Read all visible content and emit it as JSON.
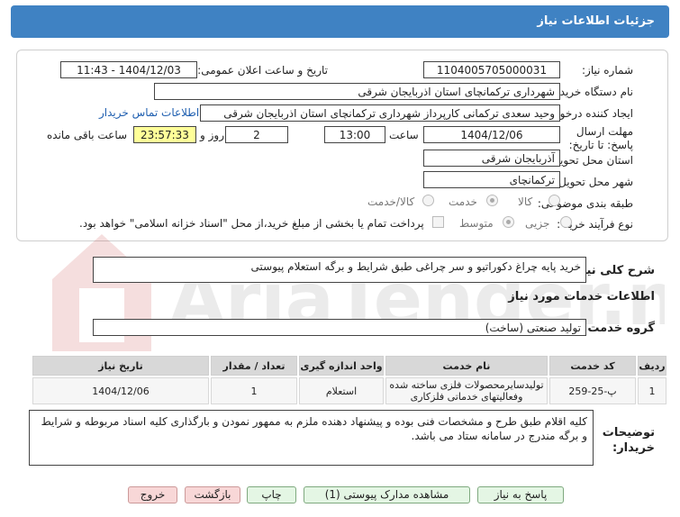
{
  "header": {
    "title": "جزئیات اطلاعات نیاز"
  },
  "form": {
    "need_number_label": "شماره نیاز:",
    "need_number": "1104005705000031",
    "announce_label": "تاریخ و ساعت اعلان عمومی:",
    "announce_value": "1404/12/03 - 11:43",
    "buyer_org_label": "نام دستگاه خریدار:",
    "buyer_org": "شهرداری ترکمانچای استان اذربایجان شرقی",
    "creator_label": "ایجاد کننده درخواست:",
    "creator": "وحید سعدی ترکمانی کارپرداز شهرداری ترکمانچای استان اذربایجان شرقی",
    "contact_link": "اطلاعات تماس خریدار",
    "deadline_label": "مهلت ارسال پاسخ: تا تاریخ:",
    "deadline_date": "1404/12/06",
    "time_label": "ساعت",
    "deadline_time": "13:00",
    "days_value": "2",
    "days_label": "روز و",
    "remaining_time": "23:57:33",
    "remaining_label": "ساعت باقی مانده",
    "province_label": "استان محل تحویل:",
    "province": "آذربایجان شرقی",
    "city_label": "شهر محل تحویل:",
    "city": "ترکمانچای",
    "category_label": "طبقه بندی موضوعی:",
    "category_options": [
      "کالا",
      "خدمت",
      "کالا/خدمت"
    ],
    "category_selected": "خدمت",
    "purchase_type_label": "نوع فرآیند خرید :",
    "purchase_options": [
      "جزیی",
      "متوسط"
    ],
    "purchase_selected": "متوسط",
    "payment_note": "پرداخت تمام یا بخشی از مبلغ خرید،از محل \"اسناد خزانه اسلامی\" خواهد بود."
  },
  "general_desc": {
    "label": "شرح کلی نیاز:",
    "value": "خرید پایه چراغ دکوراتیو و سر چراغی طبق شرایط و برگه استعلام پیوستی"
  },
  "services": {
    "section_title": "اطلاعات خدمات مورد نیاز",
    "group_label": "گروه خدمت:",
    "group_value": "تولید صنعتی (ساخت)",
    "columns": [
      "ردیف",
      "کد خدمت",
      "نام خدمت",
      "واحد اندازه گیری",
      "تعداد / مقدار",
      "تاریخ نیاز"
    ],
    "rows": [
      {
        "row": "1",
        "code": "پ-25-259",
        "name": "تولیدسایرمحصولات فلزی ساخته شده وفعالیتهای خدماتی فلزکاری",
        "unit": "استعلام",
        "qty": "1",
        "date": "1404/12/06"
      }
    ]
  },
  "buyer_notes": {
    "label": "توضیحات خریدار:",
    "value": "کلیه اقلام طبق طرح و مشخصات فنی بوده و پیشنهاد دهنده ملزم به ممهور نمودن و بارگذاری کلیه اسناد مربوطه و شرایط و برگه مندرج در سامانه ستاد می باشد."
  },
  "buttons": {
    "reply": "پاسخ به نیاز",
    "attachments": "مشاهده مدارک پیوستی (1)",
    "print": "چاپ",
    "back": "بازگشت",
    "exit": "خروج"
  },
  "watermark": {
    "text": "AriaTender.net"
  },
  "colors": {
    "header": "#3f82c3",
    "remaining_bg": "#ffff99",
    "link": "#1f5fb0"
  }
}
